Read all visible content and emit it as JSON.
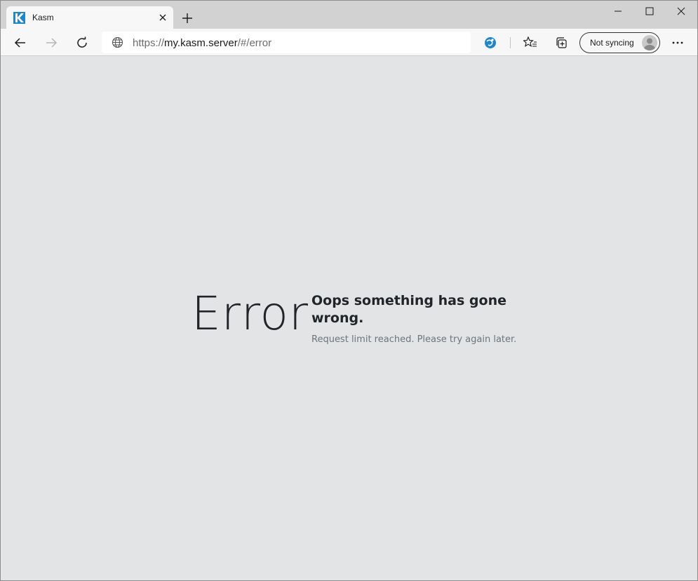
{
  "browser": {
    "tab": {
      "title": "Kasm",
      "favicon": "kasm-logo-icon"
    },
    "window_controls": [
      "minimize-icon",
      "maximize-icon",
      "close-icon"
    ],
    "address": {
      "scheme": "https://",
      "host": "my.kasm.server",
      "path": "/#/error"
    },
    "sync_label": "Not syncing",
    "colors": {
      "accent": "#1f86c8",
      "titlebar": "#d2d2d2",
      "toolbar": "#f7f7f7",
      "page": "#e3e4e6"
    }
  },
  "page": {
    "error_big": "Error",
    "heading": "Oops something has gone wrong.",
    "message": "Request limit reached. Please try again later."
  }
}
